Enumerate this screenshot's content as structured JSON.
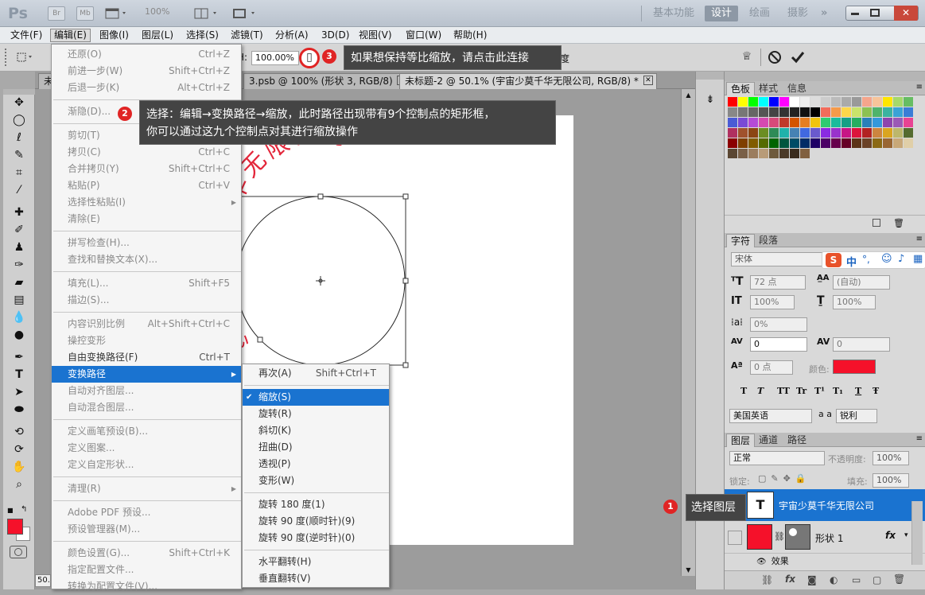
{
  "app": {
    "logo": "Ps",
    "zoom": "100%"
  },
  "titlebar": {
    "launch_br": "Br",
    "launch_mb": "Mb",
    "workspaces": [
      "基本功能",
      "设计",
      "绘画",
      "摄影"
    ],
    "active_workspace": "设计",
    "more": "»"
  },
  "menubar": {
    "items": [
      "文件(F)",
      "编辑(E)",
      "图像(I)",
      "图层(L)",
      "选择(S)",
      "滤镜(T)",
      "分析(A)",
      "3D(D)",
      "视图(V)",
      "窗口(W)",
      "帮助(H)"
    ],
    "active": "编辑(E)"
  },
  "options": {
    "h_label": "H:",
    "h_value": "100.00%",
    "angle_label": "度",
    "angle_value": "100.00"
  },
  "tabs": [
    {
      "label": "未",
      "active": false
    },
    {
      "label": "3.psb @ 100% (形状 3, RGB/8)",
      "active": false
    },
    {
      "label": "未标题-2 @ 50.1% (宇宙少莫千华无限公司, RGB/8) *",
      "active": true
    }
  ],
  "canvas": {
    "arc_text": "千华无限公司",
    "partial_text": "心"
  },
  "status_zoom": "50.",
  "edit_menu": {
    "groups": [
      [
        {
          "label": "还原(O)",
          "sc": "Ctrl+Z",
          "disabled": true
        },
        {
          "label": "前进一步(W)",
          "sc": "Shift+Ctrl+Z",
          "disabled": true
        },
        {
          "label": "后退一步(K)",
          "sc": "Alt+Ctrl+Z",
          "disabled": true
        }
      ],
      [
        {
          "label": "渐隐(D)...",
          "sc": "",
          "disabled": true
        }
      ],
      [
        {
          "label": "剪切(T)",
          "sc": "Ctrl+X",
          "disabled": true
        },
        {
          "label": "拷贝(C)",
          "sc": "Ctrl+C",
          "disabled": true
        },
        {
          "label": "合并拷贝(Y)",
          "sc": "Shift+Ctrl+C",
          "disabled": true
        },
        {
          "label": "粘贴(P)",
          "sc": "Ctrl+V",
          "disabled": true
        },
        {
          "label": "选择性粘贴(I)",
          "sc": "",
          "disabled": true,
          "sub": true
        },
        {
          "label": "清除(E)",
          "sc": "",
          "disabled": true
        }
      ],
      [
        {
          "label": "拼写检查(H)...",
          "sc": "",
          "disabled": true
        },
        {
          "label": "查找和替换文本(X)...",
          "sc": "",
          "disabled": true
        }
      ],
      [
        {
          "label": "填充(L)...",
          "sc": "Shift+F5",
          "disabled": true
        },
        {
          "label": "描边(S)...",
          "sc": "",
          "disabled": true
        }
      ],
      [
        {
          "label": "内容识别比例",
          "sc": "Alt+Shift+Ctrl+C",
          "disabled": true
        },
        {
          "label": "操控变形",
          "sc": "",
          "disabled": true
        },
        {
          "label": "自由变换路径(F)",
          "sc": "Ctrl+T",
          "disabled": false
        },
        {
          "label": "变换路径",
          "sc": "",
          "disabled": false,
          "sub": true,
          "hl": true
        },
        {
          "label": "自动对齐图层...",
          "sc": "",
          "disabled": true
        },
        {
          "label": "自动混合图层...",
          "sc": "",
          "disabled": true
        }
      ],
      [
        {
          "label": "定义画笔预设(B)...",
          "sc": "",
          "disabled": true
        },
        {
          "label": "定义图案...",
          "sc": "",
          "disabled": true
        },
        {
          "label": "定义自定形状...",
          "sc": "",
          "disabled": true
        }
      ],
      [
        {
          "label": "清理(R)",
          "sc": "",
          "disabled": true,
          "sub": true
        }
      ],
      [
        {
          "label": "Adobe PDF 预设...",
          "sc": "",
          "disabled": true
        },
        {
          "label": "预设管理器(M)...",
          "sc": "",
          "disabled": true
        }
      ],
      [
        {
          "label": "颜色设置(G)...",
          "sc": "Shift+Ctrl+K",
          "disabled": true
        },
        {
          "label": "指定配置文件...",
          "sc": "",
          "disabled": true
        },
        {
          "label": "转换为配置文件(V)...",
          "sc": "",
          "disabled": true
        }
      ]
    ]
  },
  "transform_menu": {
    "groups": [
      [
        {
          "label": "再次(A)",
          "sc": "Shift+Ctrl+T"
        }
      ],
      [
        {
          "label": "缩放(S)",
          "sc": "",
          "hl": true,
          "check": "✔"
        },
        {
          "label": "旋转(R)",
          "sc": ""
        },
        {
          "label": "斜切(K)",
          "sc": ""
        },
        {
          "label": "扭曲(D)",
          "sc": ""
        },
        {
          "label": "透视(P)",
          "sc": ""
        },
        {
          "label": "变形(W)",
          "sc": ""
        }
      ],
      [
        {
          "label": "旋转 180 度(1)",
          "sc": ""
        },
        {
          "label": "旋转 90 度(顺时针)(9)",
          "sc": ""
        },
        {
          "label": "旋转 90 度(逆时针)(0)",
          "sc": ""
        }
      ],
      [
        {
          "label": "水平翻转(H)",
          "sc": ""
        },
        {
          "label": "垂直翻转(V)",
          "sc": ""
        }
      ]
    ]
  },
  "callouts": [
    {
      "num": "1",
      "text": "选择图层"
    },
    {
      "num": "2",
      "line1": "选择：编辑→变换路径→缩放，此时路径出现带有9个控制点的矩形框，",
      "line2": "你可以通过这九个控制点对其进行缩放操作"
    },
    {
      "num": "3",
      "text": "如果想保持等比缩放，请点击此连接"
    }
  ],
  "swatches_panel": {
    "tabs": [
      "色板",
      "样式",
      "信息"
    ]
  },
  "char_panel": {
    "tabs": [
      "字符",
      "段落"
    ],
    "font": "宋体",
    "size": "72 点",
    "leading": "(自动)",
    "vscale": "100%",
    "hscale": "100%",
    "tracking_pct": "0%",
    "kerning": "0",
    "tracking": "0",
    "baseline": "0 点",
    "color_label": "颜色:",
    "styles": [
      "T",
      "T",
      "TT",
      "Tr",
      "T¹",
      "T₁",
      "T",
      "Ŧ"
    ],
    "lang": "美国英语",
    "aa_label": "a a",
    "aa": "锐利"
  },
  "ime": {
    "logo": "S",
    "mode": "中",
    "punct": "°,"
  },
  "layers_panel": {
    "tabs": [
      "图层",
      "通道",
      "路径"
    ],
    "blend": "正常",
    "opacity_label": "不透明度:",
    "opacity": "100%",
    "lock_label": "锁定:",
    "fill_label": "填充:",
    "fill": "100%",
    "layers": [
      {
        "name": "宇宙少莫千华无限公司",
        "selected": true,
        "thumb": "T"
      },
      {
        "name": "形状 1",
        "selected": false,
        "fx": "fx"
      }
    ],
    "effects_label": "效果"
  },
  "colors": {
    "fg": "#f5112a",
    "accent": "#1a73d0",
    "callout_badge": "#e02424",
    "text_color_swatch": "#f5112a"
  }
}
